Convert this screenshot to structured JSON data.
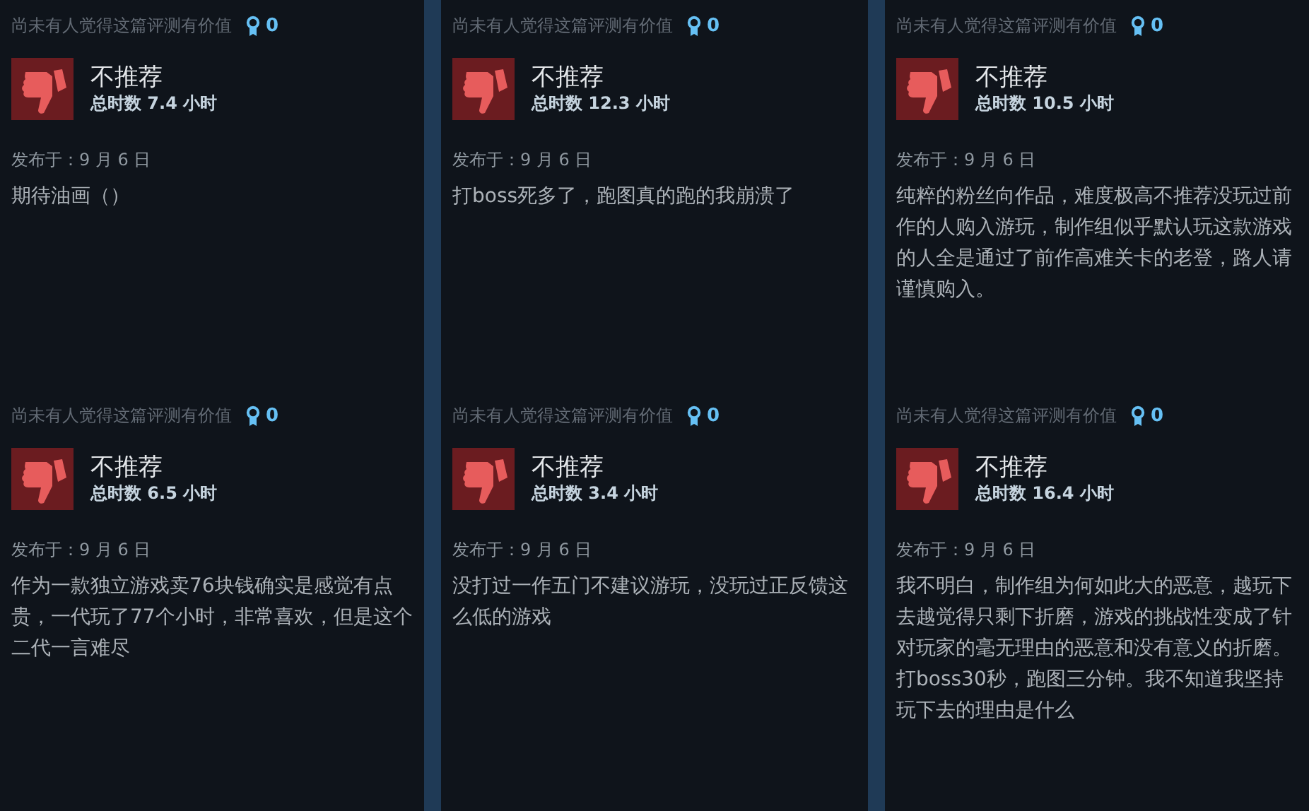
{
  "reviews": [
    {
      "helpful_text": "尚未有人觉得这篇评测有价值",
      "award_count": "0",
      "verdict": "不推荐",
      "recommended": false,
      "hours": "总时数 7.4 小时",
      "posted": "发布于：9 月 6 日",
      "body": "期待油画（）"
    },
    {
      "helpful_text": "尚未有人觉得这篇评测有价值",
      "award_count": "0",
      "verdict": "不推荐",
      "recommended": false,
      "hours": "总时数 12.3 小时",
      "posted": "发布于：9 月 6 日",
      "body": "打boss死多了，跑图真的跑的我崩溃了"
    },
    {
      "helpful_text": "尚未有人觉得这篇评测有价值",
      "award_count": "0",
      "verdict": "不推荐",
      "recommended": false,
      "hours": "总时数 10.5 小时",
      "posted": "发布于：9 月 6 日",
      "body": "纯粹的粉丝向作品，难度极高不推荐没玩过前作的人购入游玩，制作组似乎默认玩这款游戏的人全是通过了前作高难关卡的老登，路人请谨慎购入。"
    },
    {
      "helpful_text": "尚未有人觉得这篇评测有价值",
      "award_count": "0",
      "verdict": "不推荐",
      "recommended": false,
      "hours": "总时数 6.5 小时",
      "posted": "发布于：9 月 6 日",
      "body": "作为一款独立游戏卖76块钱确实是感觉有点贵，一代玩了77个小时，非常喜欢，但是这个二代一言难尽"
    },
    {
      "helpful_text": "尚未有人觉得这篇评测有价值",
      "award_count": "0",
      "verdict": "不推荐",
      "recommended": false,
      "hours": "总时数 3.4 小时",
      "posted": "发布于：9 月 6 日",
      "body": "没打过一作五门不建议游玩，没玩过正反馈这么低的游戏"
    },
    {
      "helpful_text": "尚未有人觉得这篇评测有价值",
      "award_count": "0",
      "verdict": "不推荐",
      "recommended": false,
      "hours": "总时数 16.4 小时",
      "posted": "发布于：9 月 6 日",
      "body": "我不明白，制作组为何如此大的恶意，越玩下去越觉得只剩下折磨，游戏的挑战性变成了针对玩家的毫无理由的恶意和没有意义的折磨。打boss30秒，跑图三分钟。我不知道我坚持玩下去的理由是什么"
    }
  ]
}
